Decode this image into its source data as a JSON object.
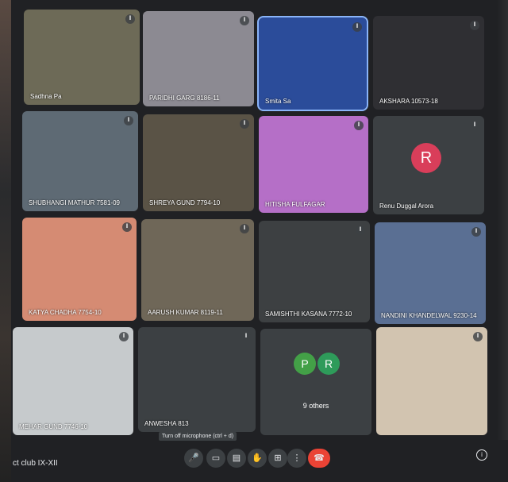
{
  "participants": [
    {
      "name": "Sadhna Pa",
      "bg": "#6d6a57"
    },
    {
      "name": "PARIDHI GARG 8186-11",
      "bg": "#8c8a92"
    },
    {
      "name": "Smita Sa",
      "bg": "#2b4c9a"
    },
    {
      "name": "AKSHARA 10573-18",
      "bg": "#2f2f33"
    },
    {
      "name": "SHUBHANGI MATHUR 7581-09",
      "bg": "#5e6a74"
    },
    {
      "name": "SHREYA GUND 7794-10",
      "bg": "#5a5346"
    },
    {
      "name": "HITISHA FULFAGAR",
      "bg": "#b56fc7"
    },
    {
      "name": "Renu Duggal Arora",
      "bg": "#3c4043"
    },
    {
      "name": "KATYA CHADHA 7754-10",
      "bg": "#d58b73"
    },
    {
      "name": "AARUSH KUMAR 8119-11",
      "bg": "#6f6758"
    },
    {
      "name": "SAMISHTHI KASANA 7772-10",
      "bg": "#3d4042"
    },
    {
      "name": "NANDINI KHANDELWAL 9230-14",
      "bg": "#5a6f93"
    },
    {
      "name": "MEHAR GUND 7746-10",
      "bg": "#c6cacc"
    },
    {
      "name": "ANWESHA 813",
      "bg": "#3c4043"
    },
    {
      "name": "",
      "bg": "#3c4043"
    },
    {
      "name": "",
      "bg": "#d2c4b0"
    }
  ],
  "renu_avatar": {
    "letter": "R",
    "color": "#d93e5a"
  },
  "others": {
    "avatars": [
      {
        "letter": "P",
        "color": "#43a047"
      },
      {
        "letter": "R",
        "color": "#2e9b5a"
      }
    ],
    "label": "9 others"
  },
  "meeting": {
    "name": "ct club IX-XII"
  },
  "tooltip": "Turn off microphone (ctrl + d)",
  "controls": [
    {
      "icon": "mic-icon",
      "glyph": "🎤"
    },
    {
      "icon": "camera-icon",
      "glyph": "▭"
    },
    {
      "icon": "captions-icon",
      "glyph": "▤"
    },
    {
      "icon": "raise-hand-icon",
      "glyph": "✋"
    },
    {
      "icon": "present-icon",
      "glyph": "⊞"
    },
    {
      "icon": "more-icon",
      "glyph": "⋮"
    },
    {
      "icon": "end-call-icon",
      "glyph": "☎"
    }
  ],
  "info_glyph": "i",
  "mic_glyph": "ǁ"
}
